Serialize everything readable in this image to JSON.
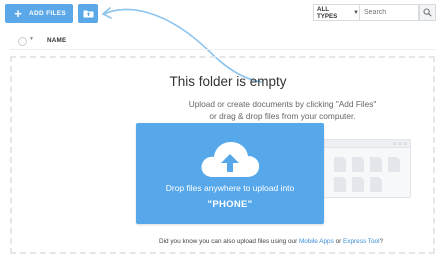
{
  "toolbar": {
    "add_files_label": "ADD FILES",
    "add_icon": "plus-icon",
    "upload_folder_icon": "folder-upload-icon",
    "filter_label": "ALL TYPES",
    "search_placeholder": "Search",
    "search_icon": "magnifier-icon"
  },
  "list_header": {
    "name_column": "NAME"
  },
  "empty_state": {
    "title": "This folder is empty",
    "subtitle_line1": "Upload or create documents by clicking \"Add Files\"",
    "subtitle_line2": "or drag & drop files from your computer."
  },
  "drop_card": {
    "text": "Drop files anywhere to upload into",
    "target": "\"PHONE\""
  },
  "tip": {
    "prefix": "Did you know you can also upload files using our ",
    "link1": "Mobile Apps",
    "middle": " or ",
    "link2": "Express Tool",
    "suffix": "?"
  },
  "colors": {
    "accent": "#5aa8e8",
    "link": "#3c8fd8"
  }
}
